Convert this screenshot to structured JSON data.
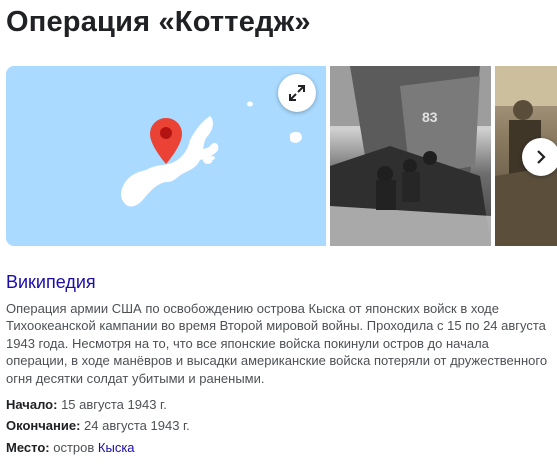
{
  "title": "Операция «Коттедж»",
  "gallery": {
    "map_icon": "map-pin-icon",
    "expand_icon": "expand-icon",
    "next_icon": "chevron-right-icon"
  },
  "source": {
    "label": "Википедия"
  },
  "description": "Операция армии США по освобождению острова Кыска от японских войск в ходе Тихоокеанской кампании во время Второй мировой войны. Проходила с 15 по 24 августа 1943 года. Несмотря на то, что все японские войска покинули остров до начала операции, в ходе манёвров и высадки американские войска потеряли от дружественного огня десятки солдат убитыми и ранеными.",
  "facts": {
    "start": {
      "label": "Начало:",
      "value": "15 августа 1943 г."
    },
    "end": {
      "label": "Окончание:",
      "value": "24 августа 1943 г."
    },
    "place": {
      "label": "Место:",
      "prefix": "остров",
      "link": "Кыска"
    }
  },
  "colors": {
    "water": "#aadaff",
    "land": "#ffffff",
    "pin": "#ea4335",
    "link": "#1a0dab"
  }
}
